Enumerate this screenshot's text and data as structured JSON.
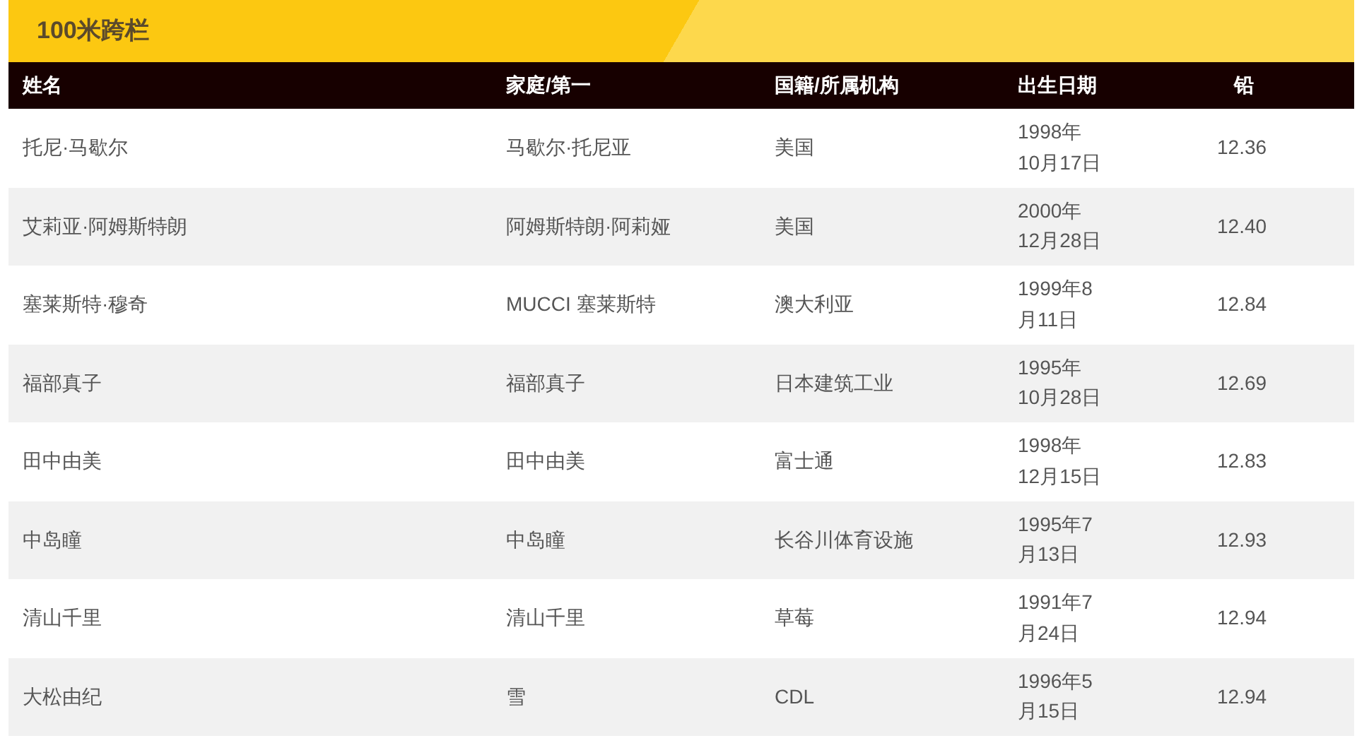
{
  "title": "100米跨栏",
  "table": {
    "columns": [
      "姓名",
      "家庭/第一",
      "国籍/所属机构",
      "出生日期",
      "铅"
    ],
    "rows": [
      [
        "托尼·马歇尔",
        "马歇尔·托尼亚",
        "美国",
        "1998年10月17日",
        "12.36"
      ],
      [
        "艾莉亚·阿姆斯特朗",
        "阿姆斯特朗·阿莉娅",
        "美国",
        "2000年12月28日",
        "12.40"
      ],
      [
        "塞莱斯特·穆奇",
        "MUCCI 塞莱斯特",
        "澳大利亚",
        "1999年8月11日",
        "12.84"
      ],
      [
        "福部真子",
        "福部真子",
        "日本建筑工业",
        "1995年10月28日",
        "12.69"
      ],
      [
        "田中由美",
        "田中由美",
        "富士通",
        "1998年12月15日",
        "12.83"
      ],
      [
        "中岛瞳",
        "中岛瞳",
        "长谷川体育设施",
        "1995年7月13日",
        "12.93"
      ],
      [
        "清山千里",
        "清山千里",
        "草莓",
        "1991年7月24日",
        "12.94"
      ],
      [
        "大松由纪",
        "雪",
        "CDL",
        "1996年5月15日",
        "12.94"
      ]
    ]
  }
}
